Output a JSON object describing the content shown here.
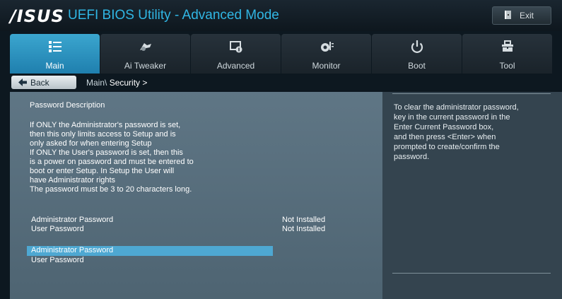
{
  "header": {
    "logo": "/ISUS",
    "title": "UEFI BIOS Utility - Advanced Mode",
    "exit_label": "Exit"
  },
  "tabs": [
    {
      "label": "Main",
      "icon": "list-icon",
      "active": true
    },
    {
      "label": "Ai Tweaker",
      "icon": "tweaker-icon",
      "active": false
    },
    {
      "label": "Advanced",
      "icon": "advanced-icon",
      "active": false
    },
    {
      "label": "Monitor",
      "icon": "monitor-icon",
      "active": false
    },
    {
      "label": "Boot",
      "icon": "power-icon",
      "active": false
    },
    {
      "label": "Tool",
      "icon": "tool-icon",
      "active": false
    }
  ],
  "breadcrumb": {
    "back_label": "Back",
    "path_prefix": "Main\\",
    "current": "Security >"
  },
  "main": {
    "description_title": "Password Description",
    "description_lines": [
      "If ONLY the Administrator's password is set,",
      "then this only limits access to Setup and is",
      "only asked for when entering Setup",
      "If ONLY the User's password is set, then this",
      "is a power on password and must be entered to",
      "boot or enter Setup. In Setup the User will",
      "have Administrator rights",
      "The password must be 3 to 20 characters long."
    ],
    "status_items": [
      {
        "label": "Administrator Password",
        "value": "Not Installed"
      },
      {
        "label": "User Password",
        "value": "Not Installed"
      }
    ],
    "menu_items": [
      {
        "label": "Administrator Password",
        "selected": true
      },
      {
        "label": "User Password",
        "selected": false
      }
    ]
  },
  "help": {
    "lines": [
      "To clear the administrator password,",
      "key in the current password in the",
      "Enter Current Password box,",
      "and then press <Enter> when",
      "prompted to create/confirm the",
      "password."
    ]
  },
  "colors": {
    "accent": "#30b6e4",
    "selection": "#4ea8d2",
    "panel": "#5f7685",
    "help_panel": "#34444f"
  }
}
